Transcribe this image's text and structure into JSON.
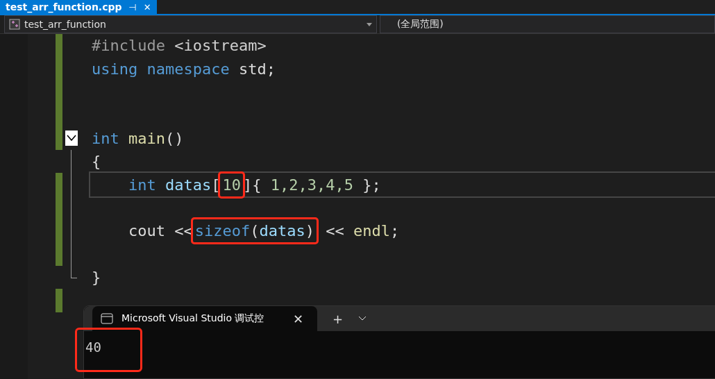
{
  "tab": {
    "title": "test_arr_function.cpp",
    "pin": "⊣",
    "close": "✕",
    "selected": true
  },
  "nav": {
    "project": "test_arr_function",
    "scope": "(全局范围)"
  },
  "code": [
    {
      "changed": true,
      "tokens": [
        {
          "kind": "preproc",
          "text": "#include"
        },
        {
          "kind": "string",
          "text": " <iostream>"
        }
      ]
    },
    {
      "changed": true,
      "tokens": [
        {
          "kind": "keyword",
          "text": "using"
        },
        {
          "kind": "keyword",
          "text": " namespace"
        },
        {
          "kind": "plain",
          "text": " std;"
        }
      ]
    },
    {
      "changed": true
    },
    {
      "changed": true
    },
    {
      "changed": true,
      "expanded": true,
      "tokens": [
        {
          "kind": "keyword",
          "text": "int"
        },
        {
          "kind": "func",
          "text": " main"
        },
        {
          "kind": "plain",
          "text": "()"
        }
      ],
      "children": [
        {
          "changed": false,
          "tokens": [
            {
              "kind": "plain",
              "text": "{"
            }
          ]
        },
        {
          "changed": true,
          "current": true,
          "tokens": [
            {
              "kind": "keyword",
              "text": "    int"
            },
            {
              "kind": "var",
              "text": " datas"
            },
            {
              "kind": "plain",
              "text": "["
            },
            {
              "kind": "highlight",
              "tokens": [
                {
                  "kind": "number",
                  "text": "10"
                }
              ]
            },
            {
              "kind": "plain",
              "text": "]{ "
            },
            {
              "kind": "number",
              "text": "1,2,3,4,5"
            },
            {
              "kind": "plain",
              "text": " };"
            }
          ]
        },
        {
          "changed": true
        },
        {
          "changed": true,
          "tokens": [
            {
              "kind": "plain",
              "text": "    cout <<"
            },
            {
              "kind": "highlight",
              "tokens": [
                {
                  "kind": "keyword",
                  "text": "sizeof"
                },
                {
                  "kind": "plain",
                  "text": "("
                },
                {
                  "kind": "var",
                  "text": "datas"
                },
                {
                  "kind": "plain",
                  "text": ")"
                }
              ]
            },
            {
              "kind": "plain",
              "text": " << "
            },
            {
              "kind": "func",
              "text": "endl"
            },
            {
              "kind": "plain",
              "text": ";"
            }
          ]
        },
        {
          "changed": true
        },
        {
          "changed": false,
          "tokens": [
            {
              "kind": "plain",
              "text": "}"
            }
          ]
        }
      ]
    },
    {
      "changed": true
    }
  ],
  "console": {
    "tab_title": "Microsoft Visual Studio 调试控",
    "close": "✕",
    "new_tab": "+",
    "output": [
      {
        "text": "40",
        "highlighted": true
      }
    ]
  }
}
